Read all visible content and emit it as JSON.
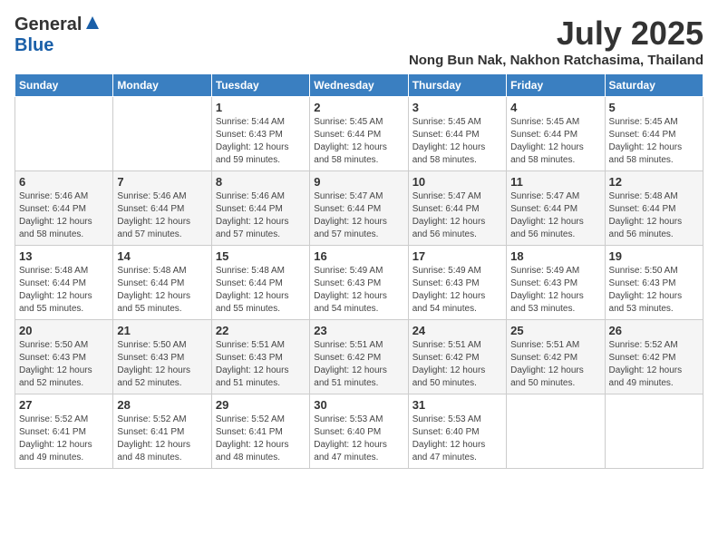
{
  "header": {
    "logo_general": "General",
    "logo_blue": "Blue",
    "month_year": "July 2025",
    "location": "Nong Bun Nak, Nakhon Ratchasima, Thailand"
  },
  "days_of_week": [
    "Sunday",
    "Monday",
    "Tuesday",
    "Wednesday",
    "Thursday",
    "Friday",
    "Saturday"
  ],
  "weeks": [
    [
      {
        "day": "",
        "info": ""
      },
      {
        "day": "",
        "info": ""
      },
      {
        "day": "1",
        "info": "Sunrise: 5:44 AM\nSunset: 6:43 PM\nDaylight: 12 hours and 59 minutes."
      },
      {
        "day": "2",
        "info": "Sunrise: 5:45 AM\nSunset: 6:44 PM\nDaylight: 12 hours and 58 minutes."
      },
      {
        "day": "3",
        "info": "Sunrise: 5:45 AM\nSunset: 6:44 PM\nDaylight: 12 hours and 58 minutes."
      },
      {
        "day": "4",
        "info": "Sunrise: 5:45 AM\nSunset: 6:44 PM\nDaylight: 12 hours and 58 minutes."
      },
      {
        "day": "5",
        "info": "Sunrise: 5:45 AM\nSunset: 6:44 PM\nDaylight: 12 hours and 58 minutes."
      }
    ],
    [
      {
        "day": "6",
        "info": "Sunrise: 5:46 AM\nSunset: 6:44 PM\nDaylight: 12 hours and 58 minutes."
      },
      {
        "day": "7",
        "info": "Sunrise: 5:46 AM\nSunset: 6:44 PM\nDaylight: 12 hours and 57 minutes."
      },
      {
        "day": "8",
        "info": "Sunrise: 5:46 AM\nSunset: 6:44 PM\nDaylight: 12 hours and 57 minutes."
      },
      {
        "day": "9",
        "info": "Sunrise: 5:47 AM\nSunset: 6:44 PM\nDaylight: 12 hours and 57 minutes."
      },
      {
        "day": "10",
        "info": "Sunrise: 5:47 AM\nSunset: 6:44 PM\nDaylight: 12 hours and 56 minutes."
      },
      {
        "day": "11",
        "info": "Sunrise: 5:47 AM\nSunset: 6:44 PM\nDaylight: 12 hours and 56 minutes."
      },
      {
        "day": "12",
        "info": "Sunrise: 5:48 AM\nSunset: 6:44 PM\nDaylight: 12 hours and 56 minutes."
      }
    ],
    [
      {
        "day": "13",
        "info": "Sunrise: 5:48 AM\nSunset: 6:44 PM\nDaylight: 12 hours and 55 minutes."
      },
      {
        "day": "14",
        "info": "Sunrise: 5:48 AM\nSunset: 6:44 PM\nDaylight: 12 hours and 55 minutes."
      },
      {
        "day": "15",
        "info": "Sunrise: 5:48 AM\nSunset: 6:44 PM\nDaylight: 12 hours and 55 minutes."
      },
      {
        "day": "16",
        "info": "Sunrise: 5:49 AM\nSunset: 6:43 PM\nDaylight: 12 hours and 54 minutes."
      },
      {
        "day": "17",
        "info": "Sunrise: 5:49 AM\nSunset: 6:43 PM\nDaylight: 12 hours and 54 minutes."
      },
      {
        "day": "18",
        "info": "Sunrise: 5:49 AM\nSunset: 6:43 PM\nDaylight: 12 hours and 53 minutes."
      },
      {
        "day": "19",
        "info": "Sunrise: 5:50 AM\nSunset: 6:43 PM\nDaylight: 12 hours and 53 minutes."
      }
    ],
    [
      {
        "day": "20",
        "info": "Sunrise: 5:50 AM\nSunset: 6:43 PM\nDaylight: 12 hours and 52 minutes."
      },
      {
        "day": "21",
        "info": "Sunrise: 5:50 AM\nSunset: 6:43 PM\nDaylight: 12 hours and 52 minutes."
      },
      {
        "day": "22",
        "info": "Sunrise: 5:51 AM\nSunset: 6:43 PM\nDaylight: 12 hours and 51 minutes."
      },
      {
        "day": "23",
        "info": "Sunrise: 5:51 AM\nSunset: 6:42 PM\nDaylight: 12 hours and 51 minutes."
      },
      {
        "day": "24",
        "info": "Sunrise: 5:51 AM\nSunset: 6:42 PM\nDaylight: 12 hours and 50 minutes."
      },
      {
        "day": "25",
        "info": "Sunrise: 5:51 AM\nSunset: 6:42 PM\nDaylight: 12 hours and 50 minutes."
      },
      {
        "day": "26",
        "info": "Sunrise: 5:52 AM\nSunset: 6:42 PM\nDaylight: 12 hours and 49 minutes."
      }
    ],
    [
      {
        "day": "27",
        "info": "Sunrise: 5:52 AM\nSunset: 6:41 PM\nDaylight: 12 hours and 49 minutes."
      },
      {
        "day": "28",
        "info": "Sunrise: 5:52 AM\nSunset: 6:41 PM\nDaylight: 12 hours and 48 minutes."
      },
      {
        "day": "29",
        "info": "Sunrise: 5:52 AM\nSunset: 6:41 PM\nDaylight: 12 hours and 48 minutes."
      },
      {
        "day": "30",
        "info": "Sunrise: 5:53 AM\nSunset: 6:40 PM\nDaylight: 12 hours and 47 minutes."
      },
      {
        "day": "31",
        "info": "Sunrise: 5:53 AM\nSunset: 6:40 PM\nDaylight: 12 hours and 47 minutes."
      },
      {
        "day": "",
        "info": ""
      },
      {
        "day": "",
        "info": ""
      }
    ]
  ]
}
